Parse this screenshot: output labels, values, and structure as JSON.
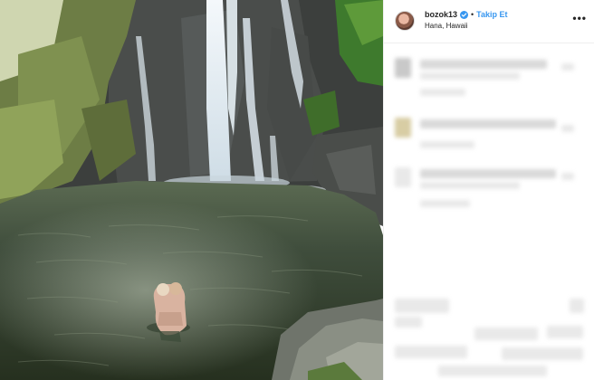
{
  "post": {
    "username": "bozok13",
    "separator": "•",
    "follow_label": "Takip Et",
    "location": "Hana, Hawaii",
    "more_icon": "more-options-icon",
    "verified_icon": "verified-badge-icon"
  },
  "colors": {
    "follow_blue": "#3897f0",
    "verified_blue": "#3897f0",
    "text": "#262626",
    "divider": "#efefef"
  }
}
